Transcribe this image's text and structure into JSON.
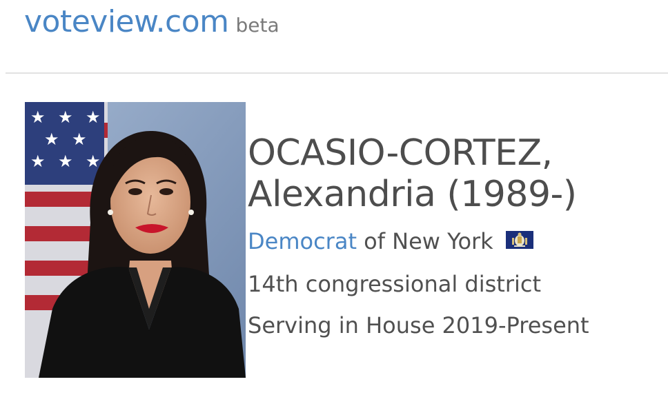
{
  "site": {
    "name": "voteview.com",
    "badge": "beta"
  },
  "member": {
    "name_line1": "OCASIO-CORTEZ,",
    "name_line2": "Alexandria (1989-)",
    "party": "Democrat",
    "state_text": "of New York",
    "state_flag_icon": "new-york-state-flag-icon",
    "district": "14th congressional district",
    "service": "Serving in House 2019-Present"
  },
  "colors": {
    "link": "#4a86c5",
    "text": "#4d4d4d",
    "badge": "#7a7a7a",
    "flag_blue": "#1a2f7a"
  }
}
